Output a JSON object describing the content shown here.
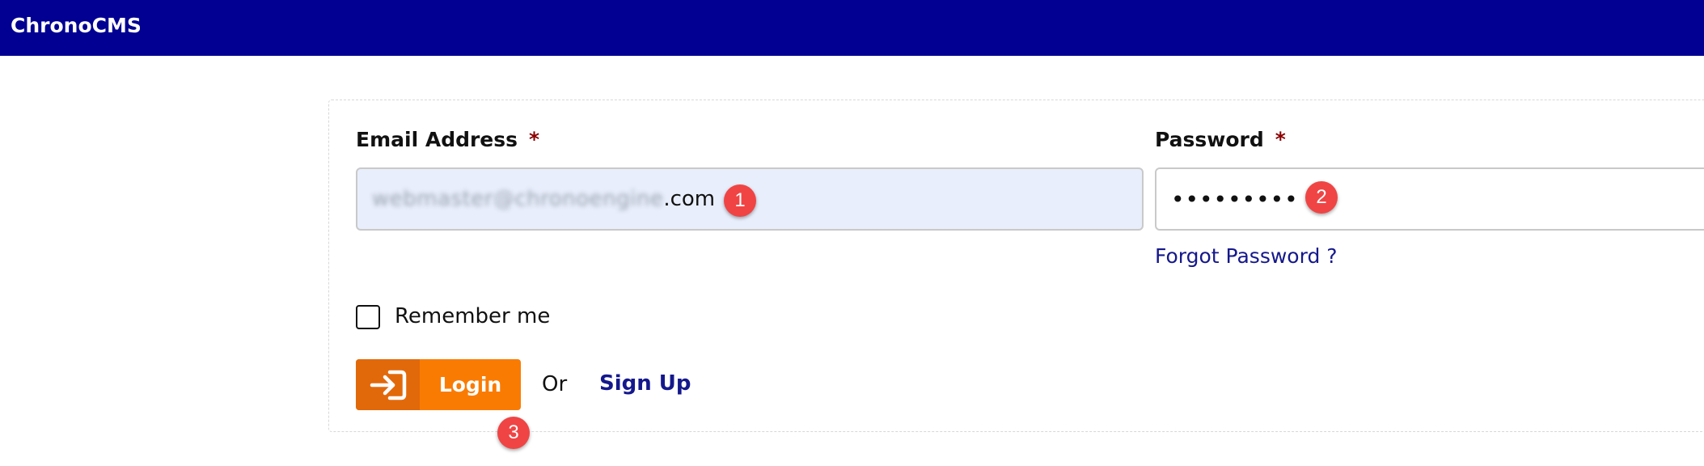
{
  "app": {
    "title": "ChronoCMS"
  },
  "form": {
    "email_label": "Email Address",
    "password_label": "Password",
    "required_marker": "*",
    "email_value_hidden": "webmaster@chronoengine",
    "email_value_visible": ".com",
    "password_value": "•••••••••",
    "forgot_password": "Forgot Password ?",
    "remember_me": "Remember me",
    "login_label": "Login",
    "or_text": "Or",
    "signup_label": "Sign Up"
  },
  "annotations": [
    "1",
    "2",
    "3"
  ],
  "colors": {
    "topbar": "#010092",
    "login_button": "#fa7b02",
    "login_icon_bg": "#e2690a",
    "link": "#15188c",
    "required": "#8b0000",
    "badge": "#f04444",
    "email_field_bg": "#e8eefb"
  },
  "icons": {
    "login": "login-arrow-icon"
  }
}
